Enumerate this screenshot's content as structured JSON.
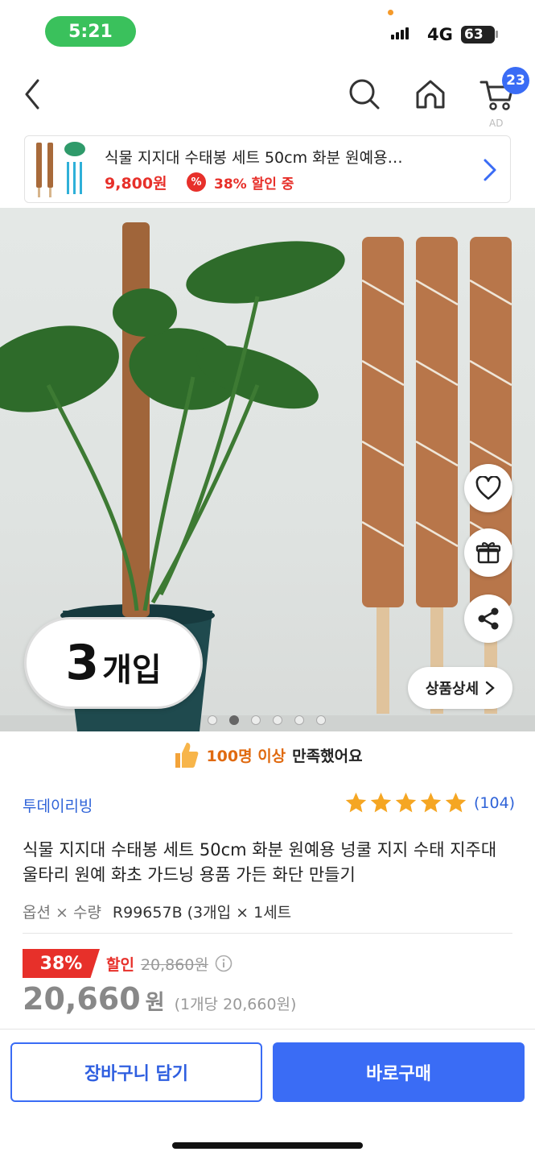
{
  "status_bar": {
    "time": "5:21",
    "network": "4G",
    "battery": "63"
  },
  "nav": {
    "cart_count": "23",
    "ad_label": "AD"
  },
  "ad_banner": {
    "title": "식물 지지대 수태봉 세트 50cm 화분 원예용…",
    "price": "9,800원",
    "discount_icon": "%",
    "discount_text": "38% 할인 중"
  },
  "hero": {
    "count_number": "3",
    "count_unit": "개입",
    "detail_button": "상품상세",
    "page_count": 6,
    "active_page": 2
  },
  "satisfaction": {
    "highlight": "100명 이상",
    "rest": "만족했어요"
  },
  "product": {
    "brand": "투데이리빙",
    "rating": 5,
    "review_count": "(104)",
    "title": "식물 지지대 수태봉 세트 50cm 화분 원예용 넝쿨 지지 수태 지주대 울타리 원예 화초 가드닝 용품 가든 화단 만들기",
    "option_label": "옵션 × 수량",
    "option_value": "R99657B (3개입 × 1세트",
    "discount_percent": "38%",
    "discount_label": "할인",
    "original_price": "20,860원",
    "price": "20,660",
    "price_unit": "원",
    "unit_price": "(1개당 20,660원)"
  },
  "actions": {
    "cart_button": "장바구니 담기",
    "buy_button": "바로구매"
  },
  "colors": {
    "accent_blue": "#3a6cf5",
    "sale_red": "#e7302a",
    "star_orange": "#f5a623",
    "status_green": "#3ac15c"
  }
}
